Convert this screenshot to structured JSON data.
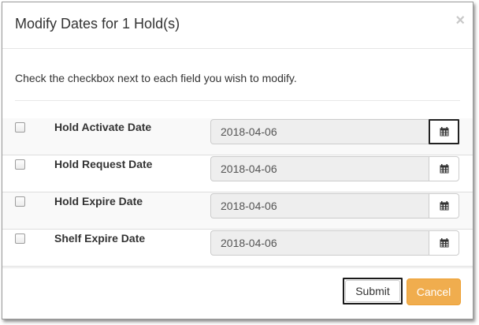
{
  "dialog": {
    "title": "Modify Dates for 1 Hold(s)",
    "close_glyph": "×",
    "instructions": "Check the checkbox next to each field you wish to modify."
  },
  "fields": [
    {
      "label": "Hold Activate Date",
      "value": "2018-04-06",
      "checked": false
    },
    {
      "label": "Hold Request Date",
      "value": "2018-04-06",
      "checked": false
    },
    {
      "label": "Hold Expire Date",
      "value": "2018-04-06",
      "checked": false
    },
    {
      "label": "Shelf Expire Date",
      "value": "2018-04-06",
      "checked": false
    }
  ],
  "footer": {
    "submit_label": "Submit",
    "cancel_label": "Cancel"
  },
  "colors": {
    "cancel_bg": "#f0ad4e",
    "field_bg": "#eeeeee"
  },
  "icons": {
    "calendar": "calendar-icon",
    "close": "close-icon"
  }
}
